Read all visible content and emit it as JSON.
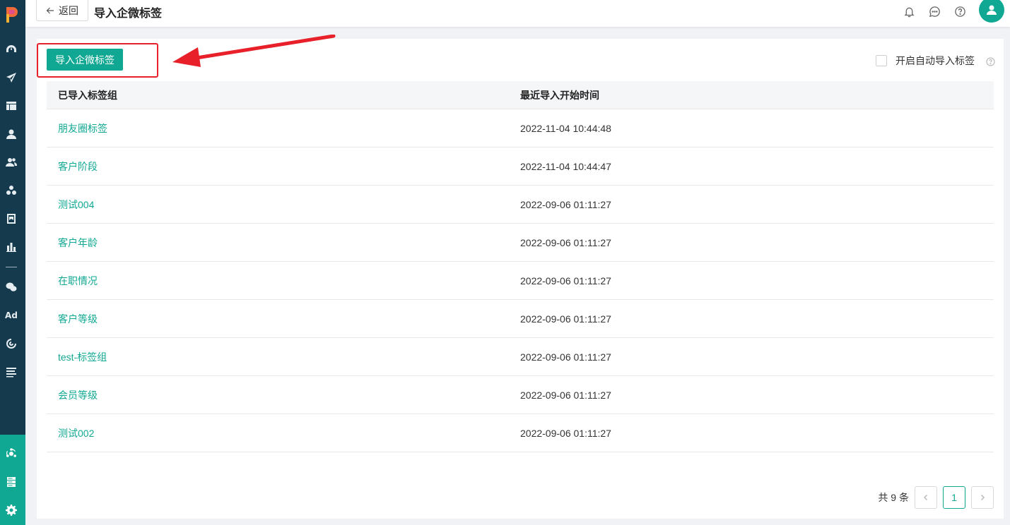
{
  "header": {
    "back_label": "返回",
    "title": "导入企微标签",
    "icons": [
      "bell-icon",
      "chat-icon",
      "help-icon",
      "user-avatar"
    ]
  },
  "sidebar": {
    "icons": [
      "dashboard-icon",
      "send-icon",
      "layout-icon",
      "user-icon",
      "users-icon",
      "cluster-icon",
      "tag-book-icon",
      "bar-chart-icon",
      "wechat-icon",
      "ad-icon",
      "loop-icon",
      "list-icon",
      "app-center-icon",
      "server-icon",
      "settings-icon"
    ],
    "ad_label": "Ad"
  },
  "main": {
    "import_button_label": "导入企微标签",
    "auto_import_label": "开启自动导入标签",
    "auto_import_checked": false,
    "table": {
      "columns": [
        "已导入标签组",
        "最近导入开始时间"
      ],
      "rows": [
        {
          "name": "朋友圈标签",
          "time": "2022-11-04 10:44:48"
        },
        {
          "name": "客户阶段",
          "time": "2022-11-04 10:44:47"
        },
        {
          "name": "测试004",
          "time": "2022-09-06 01:11:27"
        },
        {
          "name": "客户年龄",
          "time": "2022-09-06 01:11:27"
        },
        {
          "name": "在职情况",
          "time": "2022-09-06 01:11:27"
        },
        {
          "name": "客户等级",
          "time": "2022-09-06 01:11:27"
        },
        {
          "name": "test-标签组",
          "time": "2022-09-06 01:11:27"
        },
        {
          "name": "会员等级",
          "time": "2022-09-06 01:11:27"
        },
        {
          "name": "测试002",
          "time": "2022-09-06 01:11:27"
        }
      ]
    },
    "pagination": {
      "total_text": "共 9 条",
      "current_page": "1"
    }
  },
  "colors": {
    "accent": "#11a893",
    "sidebar_bg": "#163a4d",
    "annotation_red": "#e8202a"
  }
}
